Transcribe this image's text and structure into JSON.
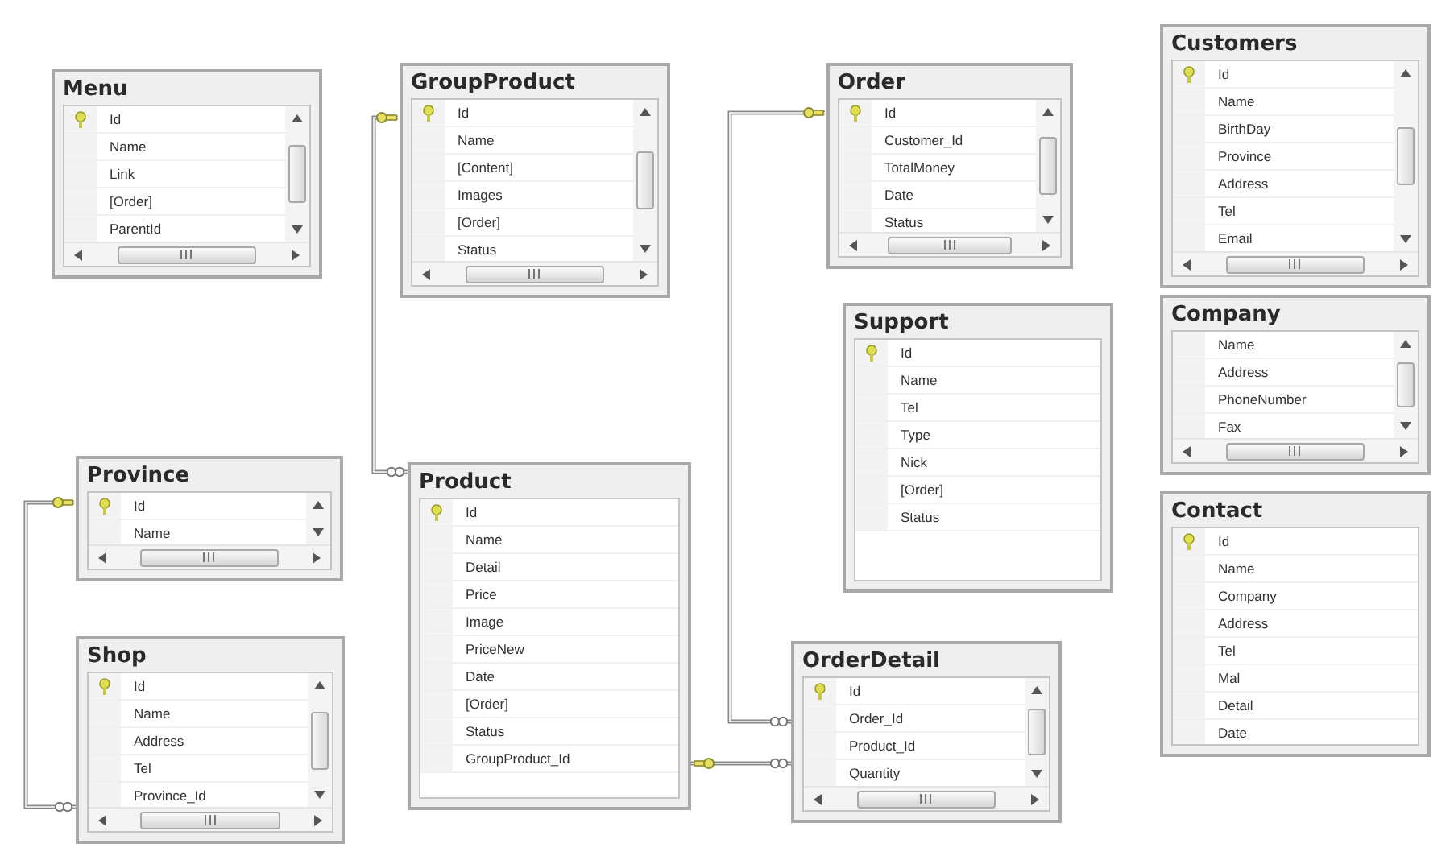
{
  "tables": [
    {
      "name": "Menu",
      "scrollbars": true,
      "columns": [
        {
          "name": "Id",
          "key": true
        },
        {
          "name": "Name",
          "key": false
        },
        {
          "name": "Link",
          "key": false
        },
        {
          "name": "[Order]",
          "key": false
        },
        {
          "name": "ParentId",
          "key": false
        }
      ]
    },
    {
      "name": "GroupProduct",
      "scrollbars": true,
      "columns": [
        {
          "name": "Id",
          "key": true
        },
        {
          "name": "Name",
          "key": false
        },
        {
          "name": "[Content]",
          "key": false
        },
        {
          "name": "Images",
          "key": false
        },
        {
          "name": "[Order]",
          "key": false
        },
        {
          "name": "Status",
          "key": false
        }
      ]
    },
    {
      "name": "Order",
      "scrollbars": true,
      "columns": [
        {
          "name": "Id",
          "key": true
        },
        {
          "name": "Customer_Id",
          "key": false
        },
        {
          "name": "TotalMoney",
          "key": false
        },
        {
          "name": "Date",
          "key": false
        },
        {
          "name": "Status",
          "key": false
        }
      ]
    },
    {
      "name": "Customers",
      "scrollbars": true,
      "columns": [
        {
          "name": "Id",
          "key": true
        },
        {
          "name": "Name",
          "key": false
        },
        {
          "name": "BirthDay",
          "key": false
        },
        {
          "name": "Province",
          "key": false
        },
        {
          "name": "Address",
          "key": false
        },
        {
          "name": "Tel",
          "key": false
        },
        {
          "name": "Email",
          "key": false
        }
      ]
    },
    {
      "name": "Support",
      "scrollbars": false,
      "columns": [
        {
          "name": "Id",
          "key": true
        },
        {
          "name": "Name",
          "key": false
        },
        {
          "name": "Tel",
          "key": false
        },
        {
          "name": "Type",
          "key": false
        },
        {
          "name": "Nick",
          "key": false
        },
        {
          "name": "[Order]",
          "key": false
        },
        {
          "name": "Status",
          "key": false
        }
      ]
    },
    {
      "name": "Company",
      "scrollbars": true,
      "columns": [
        {
          "name": "Name",
          "key": false
        },
        {
          "name": "Address",
          "key": false
        },
        {
          "name": "PhoneNumber",
          "key": false
        },
        {
          "name": "Fax",
          "key": false
        }
      ]
    },
    {
      "name": "Province",
      "scrollbars": true,
      "columns": [
        {
          "name": "Id",
          "key": true
        },
        {
          "name": "Name",
          "key": false
        }
      ]
    },
    {
      "name": "Product",
      "scrollbars": false,
      "columns": [
        {
          "name": "Id",
          "key": true
        },
        {
          "name": "Name",
          "key": false
        },
        {
          "name": "Detail",
          "key": false
        },
        {
          "name": "Price",
          "key": false
        },
        {
          "name": "Image",
          "key": false
        },
        {
          "name": "PriceNew",
          "key": false
        },
        {
          "name": "Date",
          "key": false
        },
        {
          "name": "[Order]",
          "key": false
        },
        {
          "name": "Status",
          "key": false
        },
        {
          "name": "GroupProduct_Id",
          "key": false
        }
      ]
    },
    {
      "name": "Contact",
      "scrollbars": false,
      "columns": [
        {
          "name": "Id",
          "key": true
        },
        {
          "name": "Name",
          "key": false
        },
        {
          "name": "Company",
          "key": false
        },
        {
          "name": "Address",
          "key": false
        },
        {
          "name": "Tel",
          "key": false
        },
        {
          "name": "Mal",
          "key": false
        },
        {
          "name": "Detail",
          "key": false
        },
        {
          "name": "Date",
          "key": false
        }
      ]
    },
    {
      "name": "Shop",
      "scrollbars": true,
      "columns": [
        {
          "name": "Id",
          "key": true
        },
        {
          "name": "Name",
          "key": false
        },
        {
          "name": "Address",
          "key": false
        },
        {
          "name": "Tel",
          "key": false
        },
        {
          "name": "Province_Id",
          "key": false
        }
      ]
    },
    {
      "name": "OrderDetail",
      "scrollbars": true,
      "columns": [
        {
          "name": "Id",
          "key": true
        },
        {
          "name": "Order_Id",
          "key": false
        },
        {
          "name": "Product_Id",
          "key": false
        },
        {
          "name": "Quantity",
          "key": false
        }
      ]
    }
  ]
}
